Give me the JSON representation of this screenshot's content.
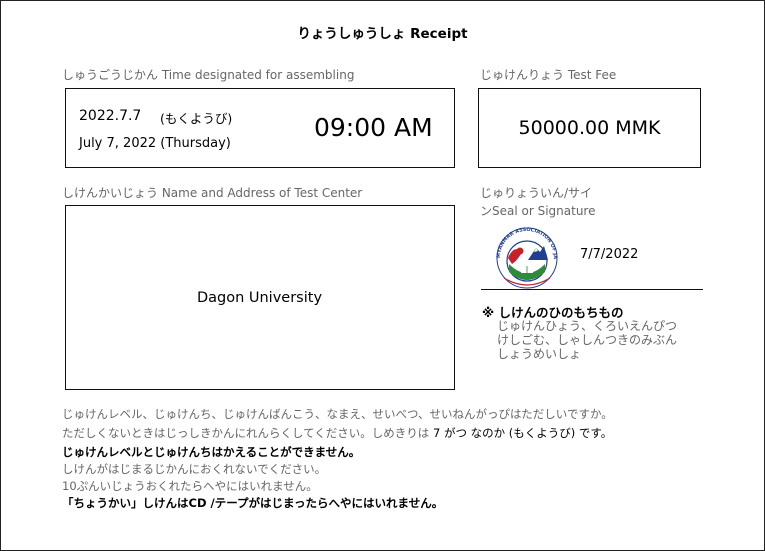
{
  "header": {
    "title": "りょうしゅうしょ  Receipt"
  },
  "assembly": {
    "label": "しゅうごうじかん   Time designated for assembling",
    "date_jp": "2022.7.7",
    "day_jp": "(もくようび)",
    "date_en": "July 7, 2022  (Thursday)",
    "time": "09:00 AM"
  },
  "fee": {
    "label": "じゅけんりょう    Test Fee",
    "amount": "50000.00 MMK"
  },
  "test_center": {
    "label": "しけんかいじょう   Name and Address of Test Center",
    "name": "Dagon University"
  },
  "signature": {
    "label_line1": "じゅりょういん/サイ",
    "label_line2": "ンSeal or Signature",
    "seal_text": "MYANMAR ASSOCIATION OF JAPAN ALUMNI",
    "date": "7/7/2022"
  },
  "belongings": {
    "title": "※ しけんのひのもちもの",
    "lines": [
      "じゅけんひょう、くろいえんぴつ",
      "けしごむ、しゃしんつきのみぶん",
      "しょうめいしょ"
    ]
  },
  "notes": {
    "line1": "じゅけんレベル、じゅけんち、じゅけんばんこう、なまえ、せいべつ、せいねんがっぴはただしいですか。",
    "line2_pre": "ただしくないときはじっしきかんにれんらくしてください。しめきりは ",
    "line2_deadline": "7 がつ なのか (もくようび) です。",
    "line3": "じゅけんレベルとじゅけんちはかえることができません。",
    "line4": "しけんがはじまるじかんにおくれないでください。",
    "line5": "10ぷんいじょうおくれたらへやにはいれません。",
    "line6": "「ちょうかい」しけんはCD /テープがはじまったらへやにはいれません。"
  },
  "colors": {
    "border": "#111111",
    "label_gray": "#666666",
    "seal_red": "#c8202a",
    "seal_green": "#2e8b3a",
    "seal_blue": "#1f3f8f"
  }
}
